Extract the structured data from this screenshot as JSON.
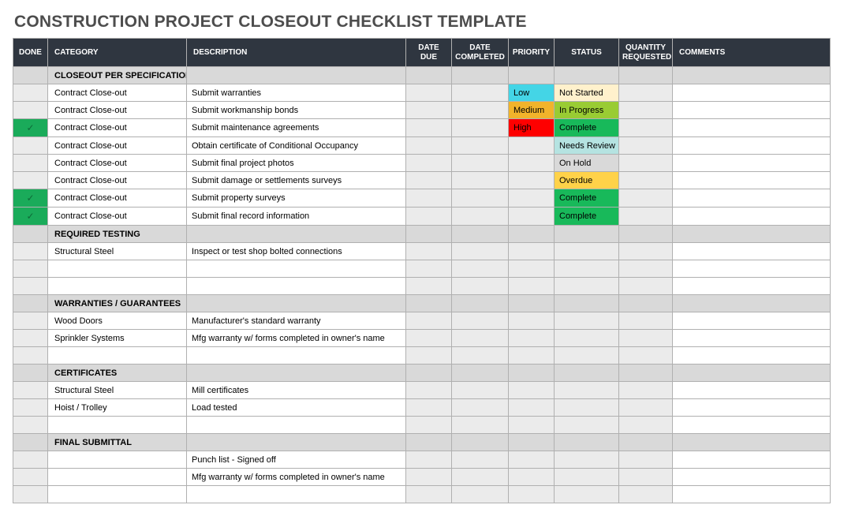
{
  "title": "CONSTRUCTION PROJECT CLOSEOUT CHECKLIST TEMPLATE",
  "headers": {
    "done": "DONE",
    "category": "CATEGORY",
    "description": "DESCRIPTION",
    "date_due": "DATE DUE",
    "date_completed": "DATE COMPLETED",
    "priority": "PRIORITY",
    "status": "STATUS",
    "quantity_requested": "QUANTITY REQUESTED",
    "comments": "COMMENTS"
  },
  "sections": [
    {
      "name": "CLOSEOUT PER SPECIFICATION",
      "rows": [
        {
          "done": false,
          "category": "Contract Close-out",
          "description": "Submit warranties",
          "date_due": "",
          "date_completed": "",
          "priority": "Low",
          "priority_class": "prio-low",
          "status": "Not Started",
          "status_class": "st-notstarted",
          "qty": "",
          "comments": ""
        },
        {
          "done": false,
          "category": "Contract Close-out",
          "description": "Submit workmanship bonds",
          "date_due": "",
          "date_completed": "",
          "priority": "Medium",
          "priority_class": "prio-medium",
          "status": "In Progress",
          "status_class": "st-inprogress",
          "qty": "",
          "comments": ""
        },
        {
          "done": true,
          "category": "Contract Close-out",
          "description": "Submit maintenance agreements",
          "date_due": "",
          "date_completed": "",
          "priority": "High",
          "priority_class": "prio-high",
          "status": "Complete",
          "status_class": "st-complete",
          "qty": "",
          "comments": ""
        },
        {
          "done": false,
          "category": "Contract Close-out",
          "description": "Obtain certificate of Conditional Occupancy",
          "date_due": "",
          "date_completed": "",
          "priority": "",
          "priority_class": "",
          "status": "Needs Review",
          "status_class": "st-needsreview",
          "qty": "",
          "comments": ""
        },
        {
          "done": false,
          "category": "Contract Close-out",
          "description": "Submit final project photos",
          "date_due": "",
          "date_completed": "",
          "priority": "",
          "priority_class": "",
          "status": "On Hold",
          "status_class": "st-onhold",
          "qty": "",
          "comments": ""
        },
        {
          "done": false,
          "category": "Contract Close-out",
          "description": "Submit damage or settlements surveys",
          "date_due": "",
          "date_completed": "",
          "priority": "",
          "priority_class": "",
          "status": "Overdue",
          "status_class": "st-overdue",
          "qty": "",
          "comments": ""
        },
        {
          "done": true,
          "category": "Contract Close-out",
          "description": "Submit property surveys",
          "date_due": "",
          "date_completed": "",
          "priority": "",
          "priority_class": "",
          "status": "Complete",
          "status_class": "st-complete",
          "qty": "",
          "comments": ""
        },
        {
          "done": true,
          "category": "Contract Close-out",
          "description": "Submit final record information",
          "date_due": "",
          "date_completed": "",
          "priority": "",
          "priority_class": "",
          "status": "Complete",
          "status_class": "st-complete",
          "qty": "",
          "comments": ""
        }
      ],
      "blanks_after": 0
    },
    {
      "name": "REQUIRED TESTING",
      "rows": [
        {
          "done": false,
          "category": "Structural Steel",
          "description": "Inspect or test shop bolted connections",
          "date_due": "",
          "date_completed": "",
          "priority": "",
          "priority_class": "",
          "status": "",
          "status_class": "",
          "qty": "",
          "comments": ""
        }
      ],
      "blanks_after": 2
    },
    {
      "name": "WARRANTIES / GUARANTEES",
      "rows": [
        {
          "done": false,
          "category": "Wood Doors",
          "description": "Manufacturer's standard warranty",
          "date_due": "",
          "date_completed": "",
          "priority": "",
          "priority_class": "",
          "status": "",
          "status_class": "",
          "qty": "",
          "comments": ""
        },
        {
          "done": false,
          "category": "Sprinkler Systems",
          "description": "Mfg warranty w/ forms completed in owner's name",
          "date_due": "",
          "date_completed": "",
          "priority": "",
          "priority_class": "",
          "status": "",
          "status_class": "",
          "qty": "",
          "comments": ""
        }
      ],
      "blanks_after": 1
    },
    {
      "name": "CERTIFICATES",
      "rows": [
        {
          "done": false,
          "category": "Structural Steel",
          "description": "Mill certificates",
          "date_due": "",
          "date_completed": "",
          "priority": "",
          "priority_class": "",
          "status": "",
          "status_class": "",
          "qty": "",
          "comments": ""
        },
        {
          "done": false,
          "category": "Hoist / Trolley",
          "description": "Load tested",
          "date_due": "",
          "date_completed": "",
          "priority": "",
          "priority_class": "",
          "status": "",
          "status_class": "",
          "qty": "",
          "comments": ""
        }
      ],
      "blanks_after": 1
    },
    {
      "name": "FINAL SUBMITTAL",
      "rows": [
        {
          "done": false,
          "category": "",
          "description": "Punch list - Signed off",
          "date_due": "",
          "date_completed": "",
          "priority": "",
          "priority_class": "",
          "status": "",
          "status_class": "",
          "qty": "",
          "comments": ""
        },
        {
          "done": false,
          "category": "",
          "description": "Mfg warranty w/ forms completed in owner's name",
          "date_due": "",
          "date_completed": "",
          "priority": "",
          "priority_class": "",
          "status": "",
          "status_class": "",
          "qty": "",
          "comments": ""
        }
      ],
      "blanks_after": 1
    }
  ]
}
